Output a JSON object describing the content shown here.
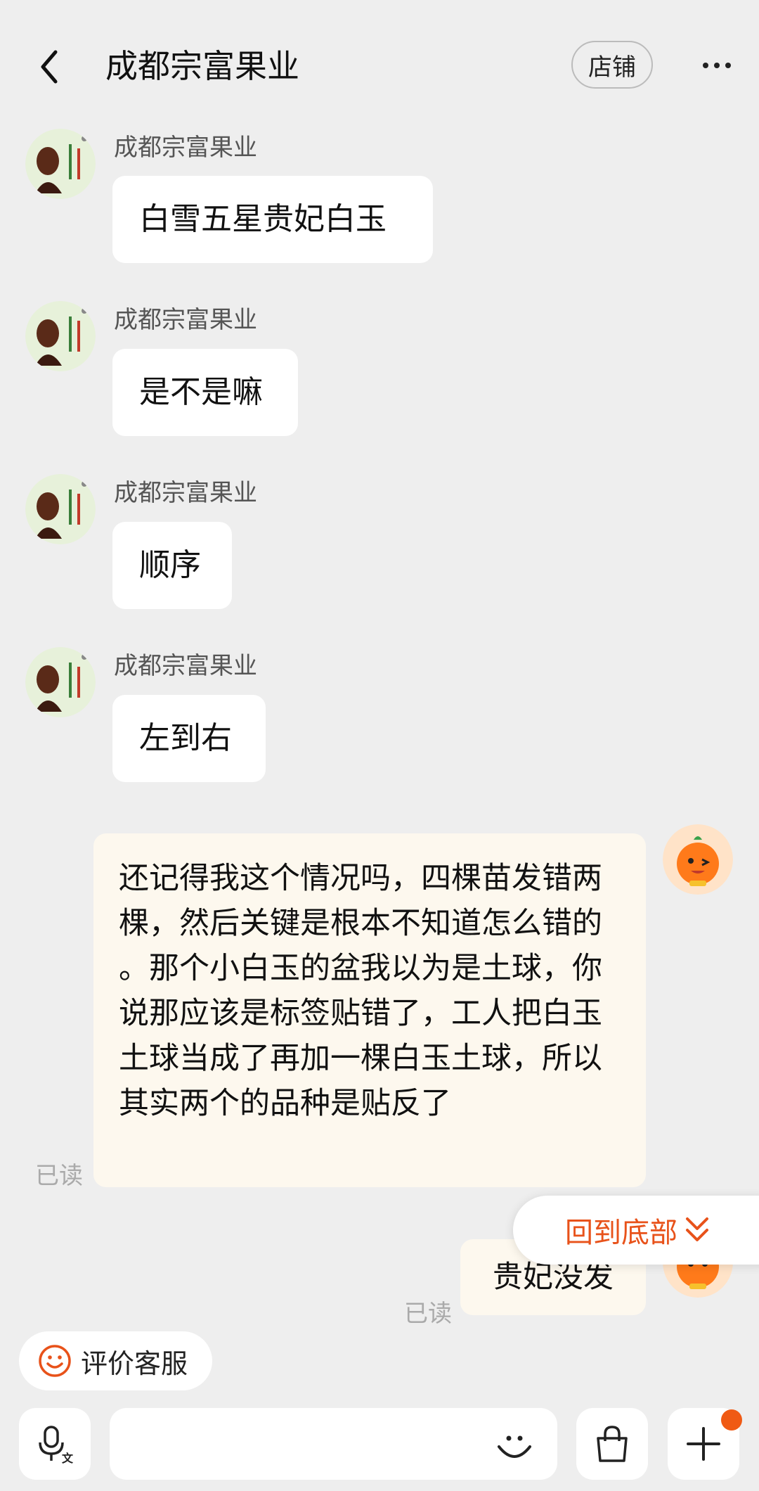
{
  "header": {
    "title": "成都宗富果业",
    "shop_label": "店铺"
  },
  "messages": [
    {
      "sender": "成都宗富果业",
      "text": "白雪五星贵妃白玉"
    },
    {
      "sender": "成都宗富果业",
      "text": "是不是嘛"
    },
    {
      "sender": "成都宗富果业",
      "text": "顺序"
    },
    {
      "sender": "成都宗富果业",
      "text": "左到右"
    }
  ],
  "my_messages": [
    {
      "text": "还记得我这个情况吗，四棵苗发错两棵，然后关键是根本不知道怎么错的 。那个小白玉的盆我以为是土球，你说那应该是标签贴错了，工人把白玉土球当成了再加一棵白玉土球，所以其实两个的品种是贴反了",
      "status": "已读"
    },
    {
      "text": "贵妃没发",
      "status": "已读"
    }
  ],
  "back_to_bottom": "回到底部",
  "eval_service": "评价客服",
  "input": {
    "placeholder": ""
  },
  "icons": {
    "back": "back-arrow-icon",
    "more": "more-dots-icon",
    "voice": "voice-input-icon",
    "emoji": "emoji-icon",
    "shopping": "shopping-bag-icon",
    "plus": "plus-icon",
    "smile": "smile-icon",
    "chevron": "double-chevron-down-icon"
  },
  "colors": {
    "accent": "#e8521a",
    "bubble_mine": "#fdf8ee",
    "bubble_other": "#ffffff",
    "background": "#eeeeee"
  }
}
